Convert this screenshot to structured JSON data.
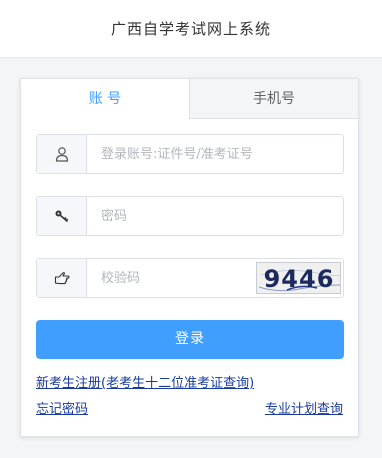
{
  "header": {
    "title": "广西自学考试网上系统"
  },
  "tabs": [
    {
      "label": "账 号",
      "active": true
    },
    {
      "label": "手机号",
      "active": false
    }
  ],
  "form": {
    "account": {
      "placeholder": "登录账号:证件号/准考证号",
      "value": "",
      "icon": "user-icon"
    },
    "password": {
      "placeholder": "密码",
      "value": "",
      "icon": "key-icon"
    },
    "captcha": {
      "placeholder": "校验码",
      "value": "",
      "icon": "hand-pointer-icon",
      "image_text": "9446"
    },
    "submit_label": "登录"
  },
  "links": {
    "register": "新考生注册(老考生十二位准考证查询)",
    "forgot_password": "忘记密码",
    "plan_query": "专业计划查询"
  },
  "colors": {
    "accent": "#409eff",
    "link": "#1a3b9c",
    "captcha_text": "#1c2a5e"
  }
}
